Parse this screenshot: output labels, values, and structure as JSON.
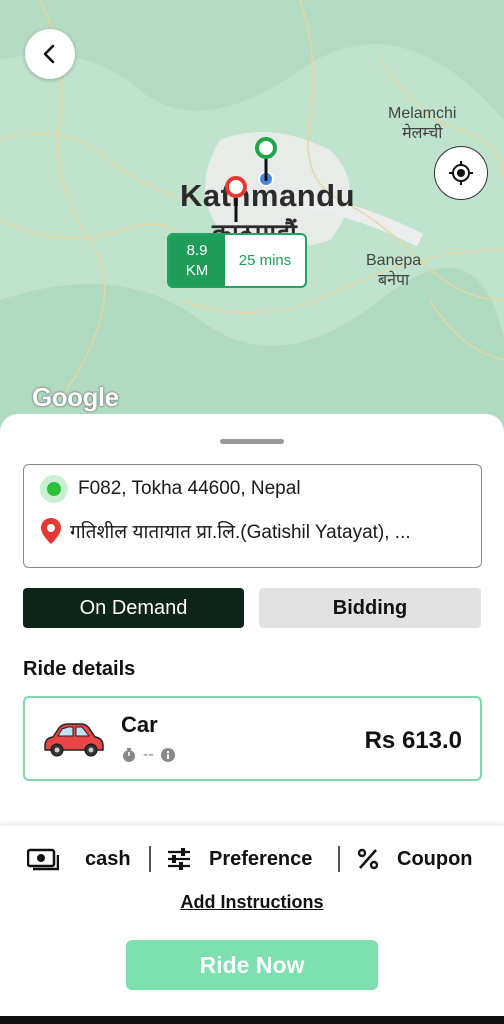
{
  "map": {
    "city_name": "Kathmandu",
    "city_name_dev": "काठमाडौं",
    "towns": [
      {
        "name": "Melamchi",
        "name_dev": "मेलम्ची"
      },
      {
        "name": "Banepa",
        "name_dev": "बनेपा"
      }
    ],
    "route": {
      "distance_value": "8.9",
      "distance_unit": "KM",
      "duration": "25 mins"
    },
    "attribution": "Google"
  },
  "addresses": {
    "pickup": "F082, Tokha 44600, Nepal",
    "drop": "गतिशील यातायात प्रा.लि.(Gatishil Yatayat), ..."
  },
  "tabs": [
    {
      "label": "On Demand",
      "active": true
    },
    {
      "label": "Bidding",
      "active": false
    }
  ],
  "ride_details": {
    "title": "Ride details",
    "vehicle": "Car",
    "eta": "--",
    "price": "Rs 613.0"
  },
  "options": {
    "payment": "cash",
    "preference": "Preference",
    "coupon": "Coupon"
  },
  "add_instructions": "Add Instructions",
  "ride_now": "Ride Now",
  "colors": {
    "primary_green": "#1f9d5a",
    "tab_active": "#0f2418",
    "button_disabled": "#7ee0b0",
    "pickup_dot": "#2bbf3a",
    "drop_pin": "#e53935"
  }
}
